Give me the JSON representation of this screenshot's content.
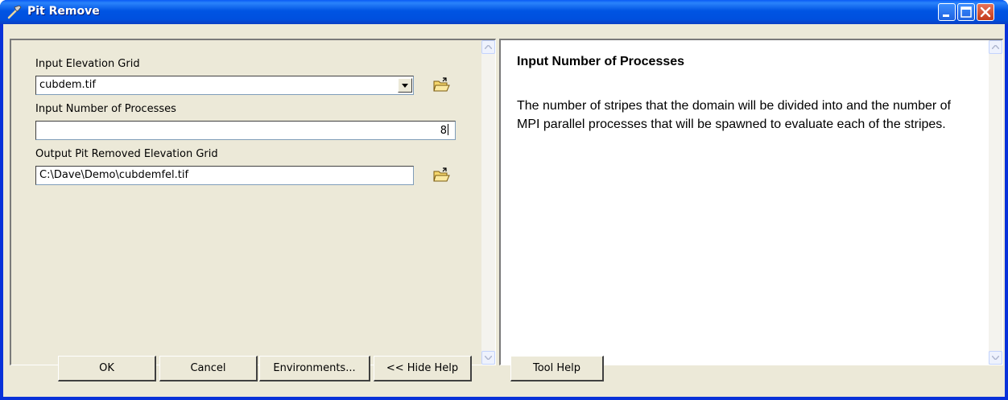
{
  "window": {
    "title": "Pit Remove",
    "icon": "hammer-tool-icon",
    "controls": [
      "minimize-icon",
      "maximize-icon",
      "close-icon"
    ]
  },
  "form": {
    "elevation_grid": {
      "label": "Input Elevation Grid",
      "value": "cubdem.tif"
    },
    "num_processes": {
      "label": "Input Number of Processes",
      "value": "8"
    },
    "output_grid": {
      "label": "Output Pit Removed Elevation Grid",
      "value": "C:\\Dave\\Demo\\cubdemfel.tif"
    }
  },
  "help": {
    "title": "Input Number of Processes",
    "body": "The number of stripes that the domain will be divided into and the number of MPI parallel processes that will be spawned to evaluate each of the stripes."
  },
  "buttons": {
    "ok": "OK",
    "cancel": "Cancel",
    "environments": "Environments...",
    "hide_help": "<< Hide Help",
    "tool_help": "Tool Help"
  },
  "colors": {
    "titlebar": "#0054e3",
    "dialog_bg": "#ece9d8",
    "close_button": "#c23a1a"
  }
}
